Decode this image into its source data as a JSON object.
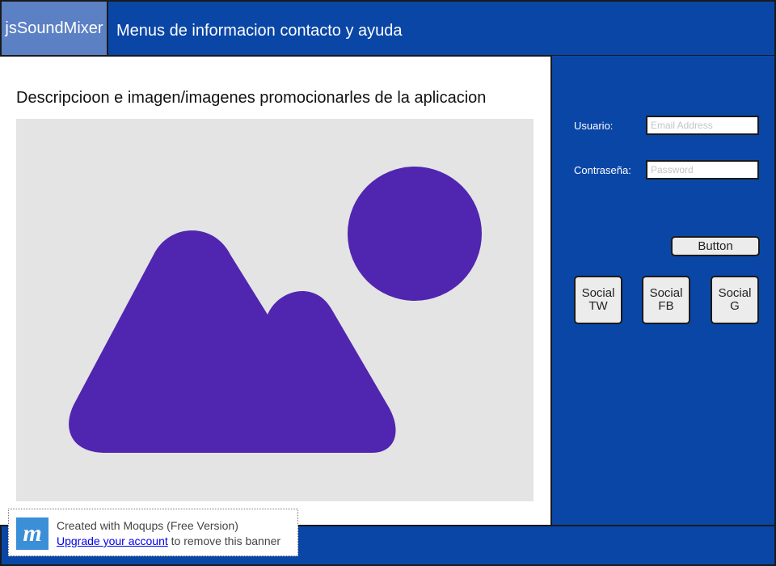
{
  "header": {
    "logo": "jsSoundMixer",
    "menu": "Menus de informacion contacto y ayuda"
  },
  "main": {
    "title": "Descripcioon e imagen/imagenes promocionarles de la aplicacion",
    "image_icon": "image-placeholder-icon",
    "image_color": "#5025b0"
  },
  "login": {
    "user_label": "Usuario:",
    "user_placeholder": "Email Address",
    "password_label": "Contraseña:",
    "password_placeholder": "Password",
    "button_label": "Button"
  },
  "social": [
    {
      "label": "Social\nTW"
    },
    {
      "label": "Social\nFB"
    },
    {
      "label": "Social G"
    }
  ],
  "banner": {
    "logo_letter": "m",
    "line1": "Created with Moqups (Free Version)",
    "link": "Upgrade your account",
    "rest": " to remove this banner"
  },
  "colors": {
    "primary": "#0a46a6",
    "logo_bg": "#5b80c4",
    "image_bg": "#e4e4e4",
    "banner_logo": "#3b8fd6"
  }
}
